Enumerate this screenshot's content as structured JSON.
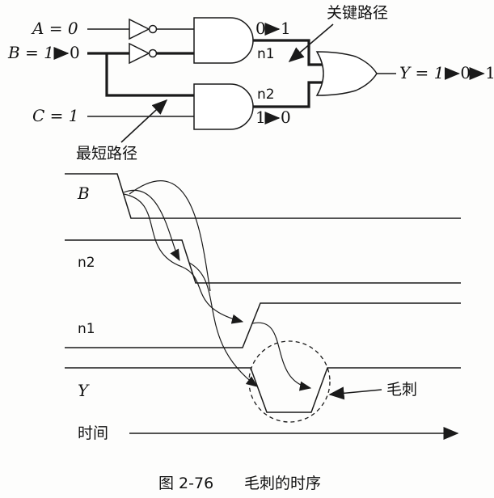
{
  "circuit": {
    "input_a": "A = 0",
    "input_b": "B = 1",
    "input_b_to": "0",
    "input_c": "C = 1",
    "n1_transition": "0",
    "n1_transition_to": "1",
    "n1_label": "n1",
    "n2_label": "n2",
    "n2_transition": "1",
    "n2_transition_to": "0",
    "output_y": "Y = 1",
    "output_y_mid": "0",
    "output_y_to": "1",
    "critical_path_label": "关键路径",
    "short_path_label": "最短路径"
  },
  "timing": {
    "signal_b": "B",
    "signal_n2": "n2",
    "signal_n1": "n1",
    "signal_y": "Y",
    "glitch_label": "毛刺",
    "time_label": "时间"
  },
  "caption": {
    "figure_number": "图 2-76",
    "title": "毛刺的时序"
  }
}
